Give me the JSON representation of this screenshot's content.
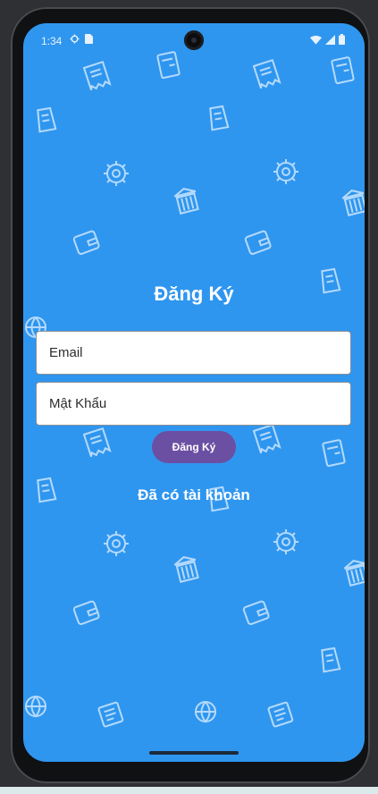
{
  "status_bar": {
    "time": "1:34",
    "left_icons": [
      "gear-icon",
      "sim-card-icon"
    ],
    "right_icons": [
      "wifi-icon",
      "signal-icon",
      "battery-icon"
    ]
  },
  "screen": {
    "background_color": "#2f96ef",
    "pattern_icons": [
      "receipt-icon",
      "wallet-icon",
      "globe-icon",
      "gear-icon",
      "building-icon",
      "coin-bag-icon"
    ]
  },
  "form": {
    "title": "Đăng Ký",
    "email_placeholder": "Email",
    "password_placeholder": "Mật Khẩu",
    "register_button_label": "Đăng Ký",
    "button_color": "#6b4fa3",
    "login_link": "Đã có tài khoản"
  }
}
